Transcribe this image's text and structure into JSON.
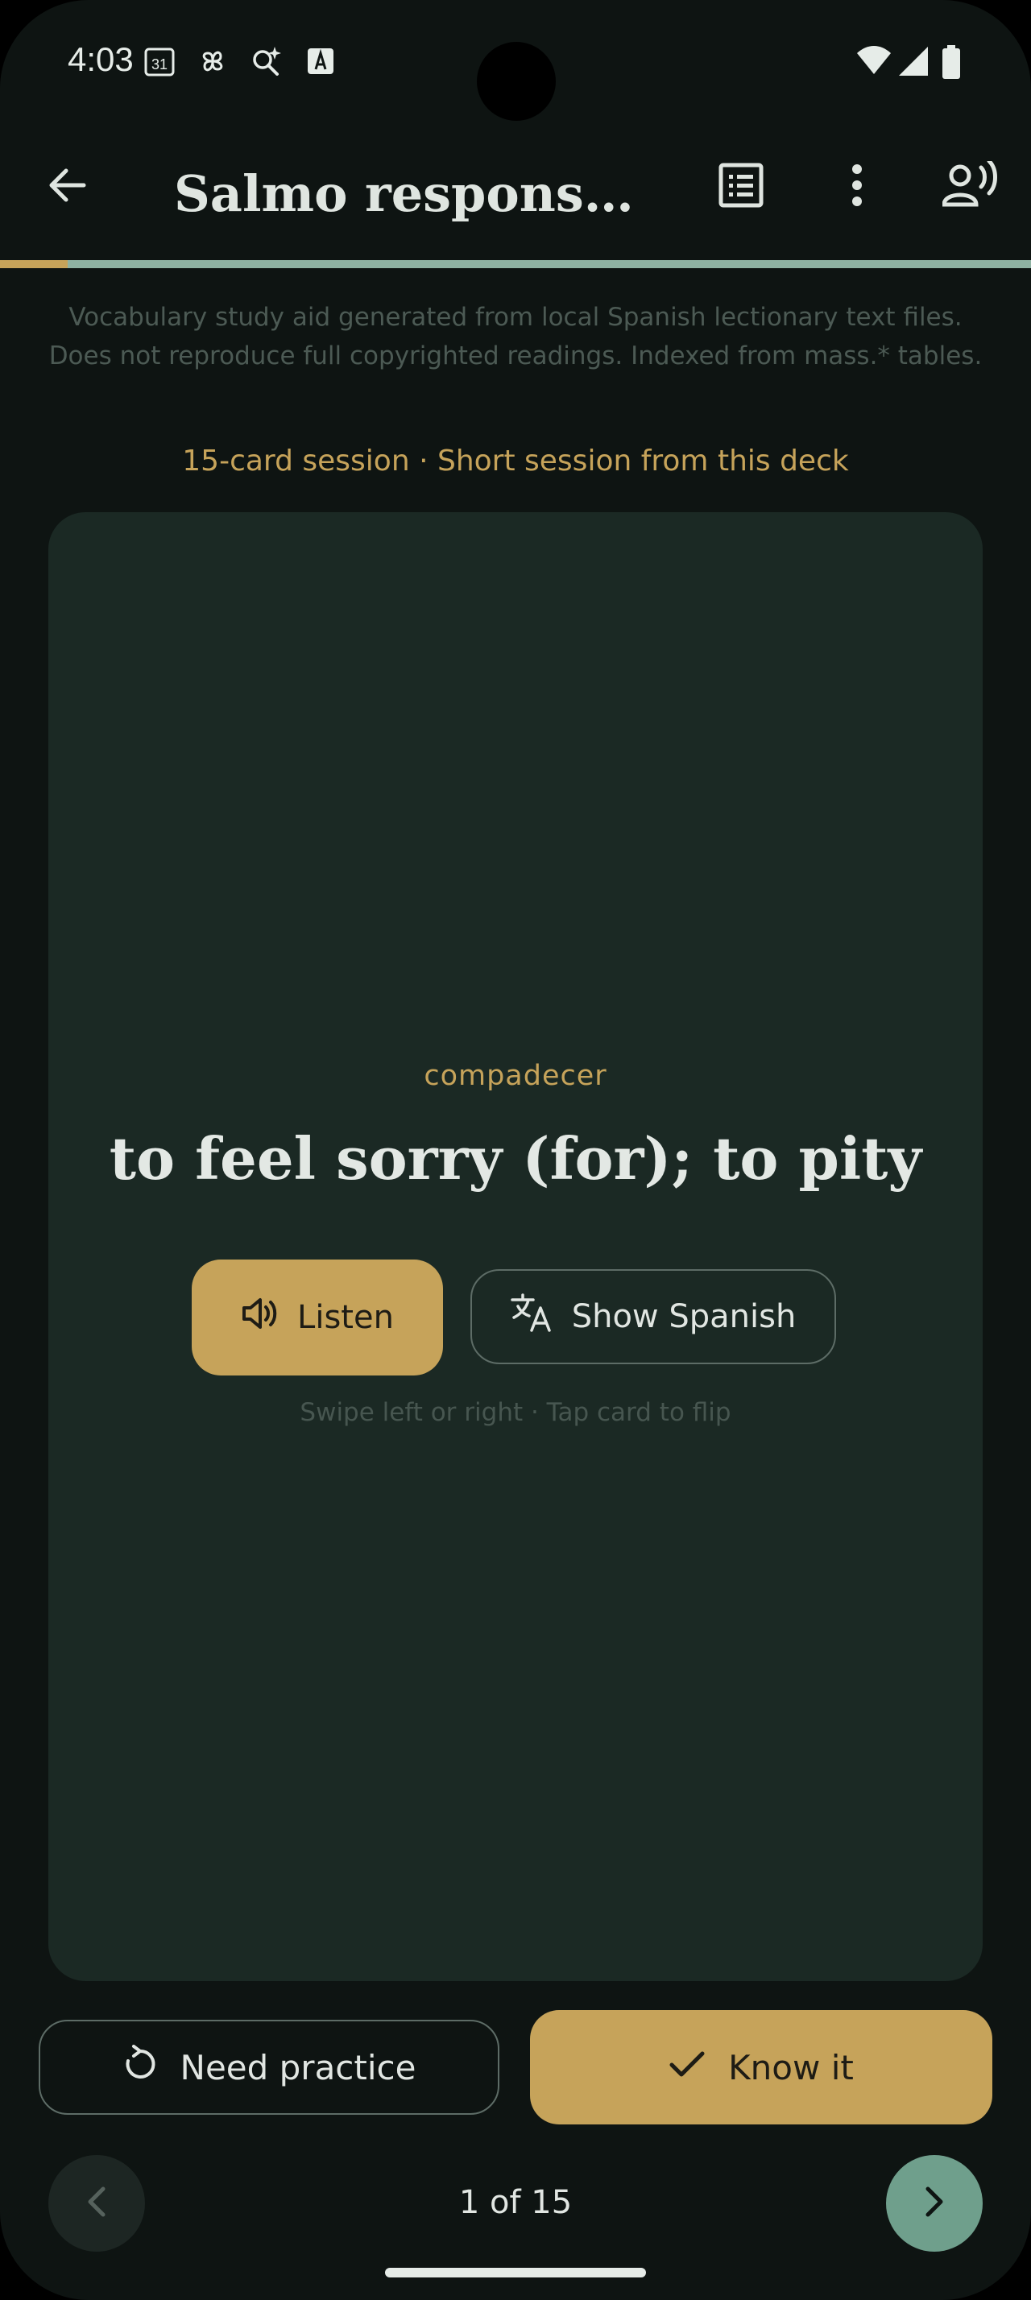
{
  "status_bar": {
    "time": "4:03",
    "calendar_icon_text": "31",
    "left_icons": [
      "calendar-icon",
      "pinwheel-icon",
      "sparkle-search-icon",
      "keyboard-a-icon"
    ],
    "right_icons": [
      "wifi-icon",
      "cell-signal-icon",
      "battery-icon"
    ]
  },
  "app_bar": {
    "title": "Salmo responsor...",
    "icons": [
      "back-arrow-icon",
      "list-icon",
      "more-vert-icon",
      "voice-person-icon"
    ]
  },
  "progress": {
    "fraction": 0.066,
    "track_color": "#8eb2a2",
    "fill_color": "#c6a35a"
  },
  "disclaimer": "Vocabulary study aid generated from local Spanish lectionary text files. Does not reproduce full copyrighted readings. Indexed from mass.* tables.",
  "session_label": "15-card session · Short session from this deck",
  "card": {
    "term": "compadecer",
    "definition": "to feel sorry (for); to pity",
    "listen_label": "Listen",
    "show_spanish_label": "Show Spanish",
    "hint": "Swipe left or right · Tap card to flip"
  },
  "actions": {
    "need_practice_label": "Need practice",
    "know_it_label": "Know it"
  },
  "pager": {
    "label": "1 of 15",
    "current": 1,
    "total": 15
  },
  "colors": {
    "accent": "#c6a35a",
    "background": "#0e1412",
    "card": "#1b2924",
    "teal": "#6f9f8c"
  }
}
